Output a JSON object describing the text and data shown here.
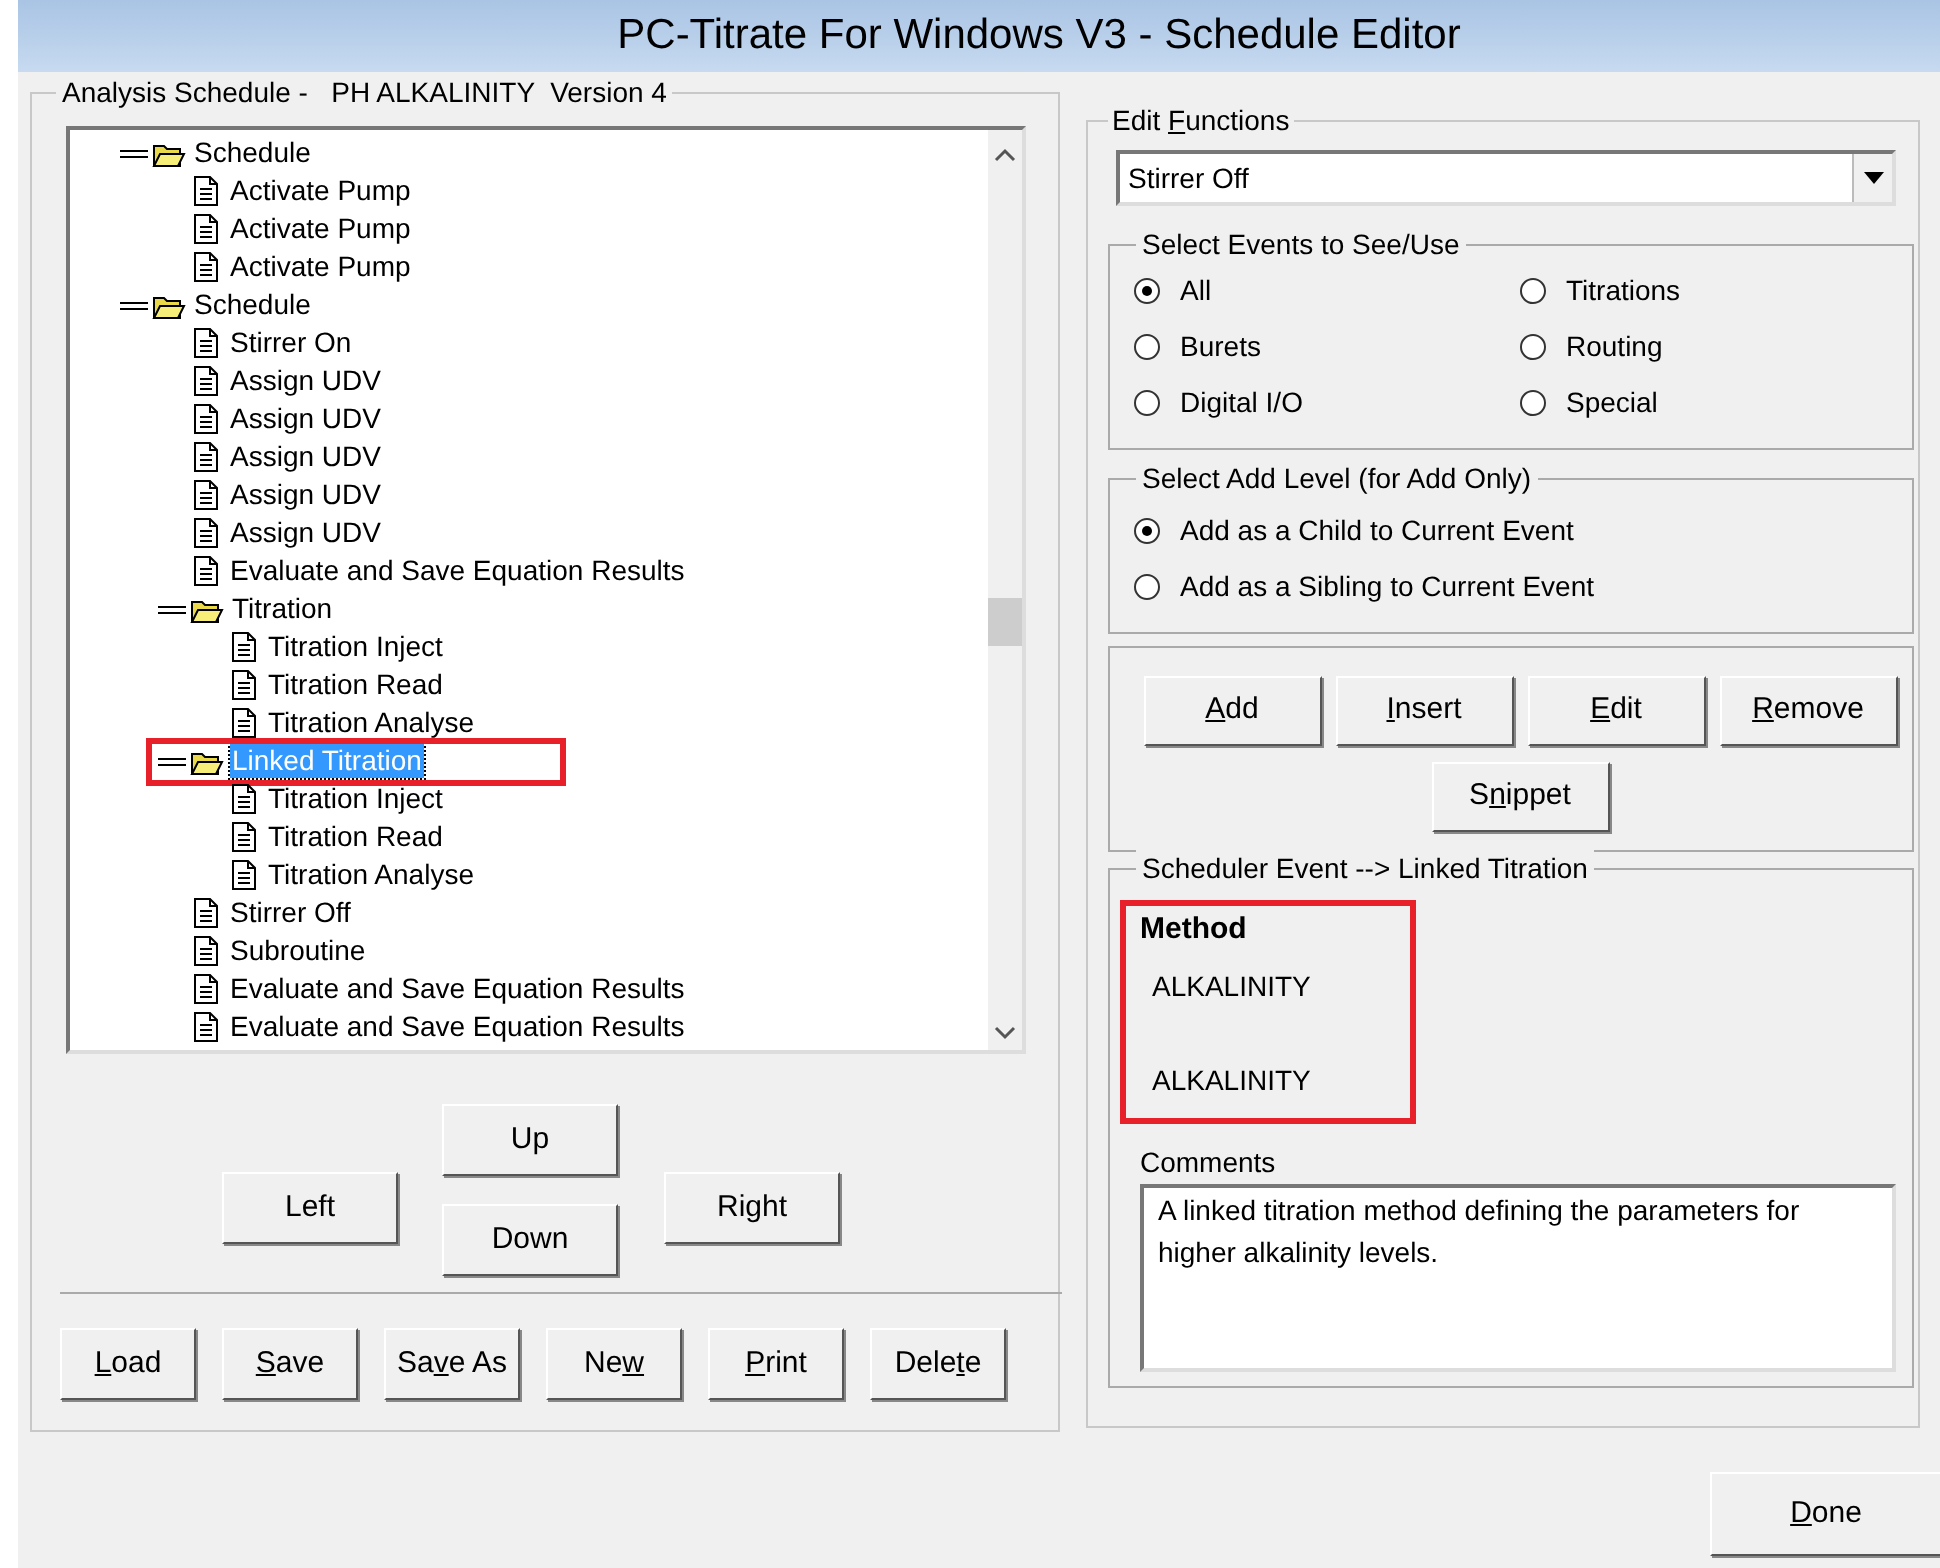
{
  "window": {
    "title": "PC-Titrate For Windows V3 - Schedule Editor"
  },
  "schedule_panel": {
    "title": "Analysis Schedule -   PH ALKALINITY  Version 4",
    "tree": [
      {
        "label": "Schedule",
        "kind": "folder",
        "expanded": true,
        "selected": false,
        "children": [
          {
            "label": "Activate Pump",
            "kind": "event",
            "selected": false
          },
          {
            "label": "Activate Pump",
            "kind": "event",
            "selected": false
          },
          {
            "label": "Activate Pump",
            "kind": "event",
            "selected": false
          }
        ]
      },
      {
        "label": "Schedule",
        "kind": "folder",
        "expanded": true,
        "selected": false,
        "children": [
          {
            "label": "Stirrer On",
            "kind": "event",
            "selected": false
          },
          {
            "label": "Assign UDV",
            "kind": "event",
            "selected": false
          },
          {
            "label": "Assign UDV",
            "kind": "event",
            "selected": false
          },
          {
            "label": "Assign UDV",
            "kind": "event",
            "selected": false
          },
          {
            "label": "Assign UDV",
            "kind": "event",
            "selected": false
          },
          {
            "label": "Assign UDV",
            "kind": "event",
            "selected": false
          },
          {
            "label": "Evaluate and Save Equation Results",
            "kind": "event",
            "selected": false
          },
          {
            "label": "Titration",
            "kind": "folder",
            "expanded": true,
            "selected": false,
            "children": [
              {
                "label": "Titration Inject",
                "kind": "event",
                "selected": false
              },
              {
                "label": "Titration Read",
                "kind": "event",
                "selected": false
              },
              {
                "label": "Titration Analyse",
                "kind": "event",
                "selected": false
              }
            ]
          },
          {
            "label": "Linked Titration",
            "kind": "folder",
            "expanded": true,
            "selected": true,
            "annotated": true,
            "children": [
              {
                "label": "Titration Inject",
                "kind": "event",
                "selected": false
              },
              {
                "label": "Titration Read",
                "kind": "event",
                "selected": false
              },
              {
                "label": "Titration Analyse",
                "kind": "event",
                "selected": false
              }
            ]
          },
          {
            "label": "Stirrer Off",
            "kind": "event",
            "selected": false
          },
          {
            "label": "Subroutine",
            "kind": "event",
            "selected": false
          },
          {
            "label": "Evaluate and Save Equation Results",
            "kind": "event",
            "selected": false
          },
          {
            "label": "Evaluate and Save Equation Results",
            "kind": "event",
            "selected": false
          }
        ]
      }
    ],
    "move_buttons": [
      {
        "label": "Left"
      },
      {
        "label": "Up"
      },
      {
        "label": "Down"
      },
      {
        "label": "Right"
      }
    ],
    "file_buttons": [
      {
        "key": "L",
        "post": "oad"
      },
      {
        "key": "S",
        "post": "ave"
      },
      {
        "pre": "Sa",
        "key": "v",
        "post": "e As"
      },
      {
        "pre": "Ne",
        "key": "w"
      },
      {
        "key": "P",
        "post": "rint"
      },
      {
        "pre": "Dele",
        "key": "t",
        "post": "e"
      }
    ]
  },
  "edit_functions": {
    "title": {
      "pre": "Edit ",
      "key": "F",
      "post": "unctions"
    },
    "dropdown_value": "Stirrer Off",
    "events_group": {
      "title": "Select Events to See/Use",
      "options": [
        {
          "label": "All",
          "selected": true
        },
        {
          "label": "Titrations",
          "selected": false
        },
        {
          "label": "Burets",
          "selected": false
        },
        {
          "label": "Routing",
          "selected": false
        },
        {
          "label": "Digital I/O",
          "selected": false
        },
        {
          "label": "Special",
          "selected": false
        }
      ]
    },
    "add_level_group": {
      "title": "Select Add Level (for Add Only)",
      "options": [
        {
          "label": "Add as a Child to Current Event",
          "selected": true
        },
        {
          "label": "Add as a Sibling to Current Event",
          "selected": false
        }
      ]
    },
    "action_buttons": [
      {
        "key": "A",
        "post": "dd"
      },
      {
        "key": "I",
        "post": "nsert"
      },
      {
        "key": "E",
        "post": "dit"
      },
      {
        "key": "R",
        "post": "emove"
      },
      {
        "pre": "S",
        "key": "n",
        "post": "ippet"
      }
    ],
    "event_group": {
      "title": "Scheduler Event --> Linked Titration",
      "method_label": "Method",
      "methods": [
        "ALKALINITY",
        "ALKALINITY"
      ],
      "method_annotated": true,
      "comments_label": "Comments",
      "comments": "A linked titration method defining the parameters for higher alkalinity levels."
    }
  },
  "done_button": {
    "key": "D",
    "post": "one"
  }
}
